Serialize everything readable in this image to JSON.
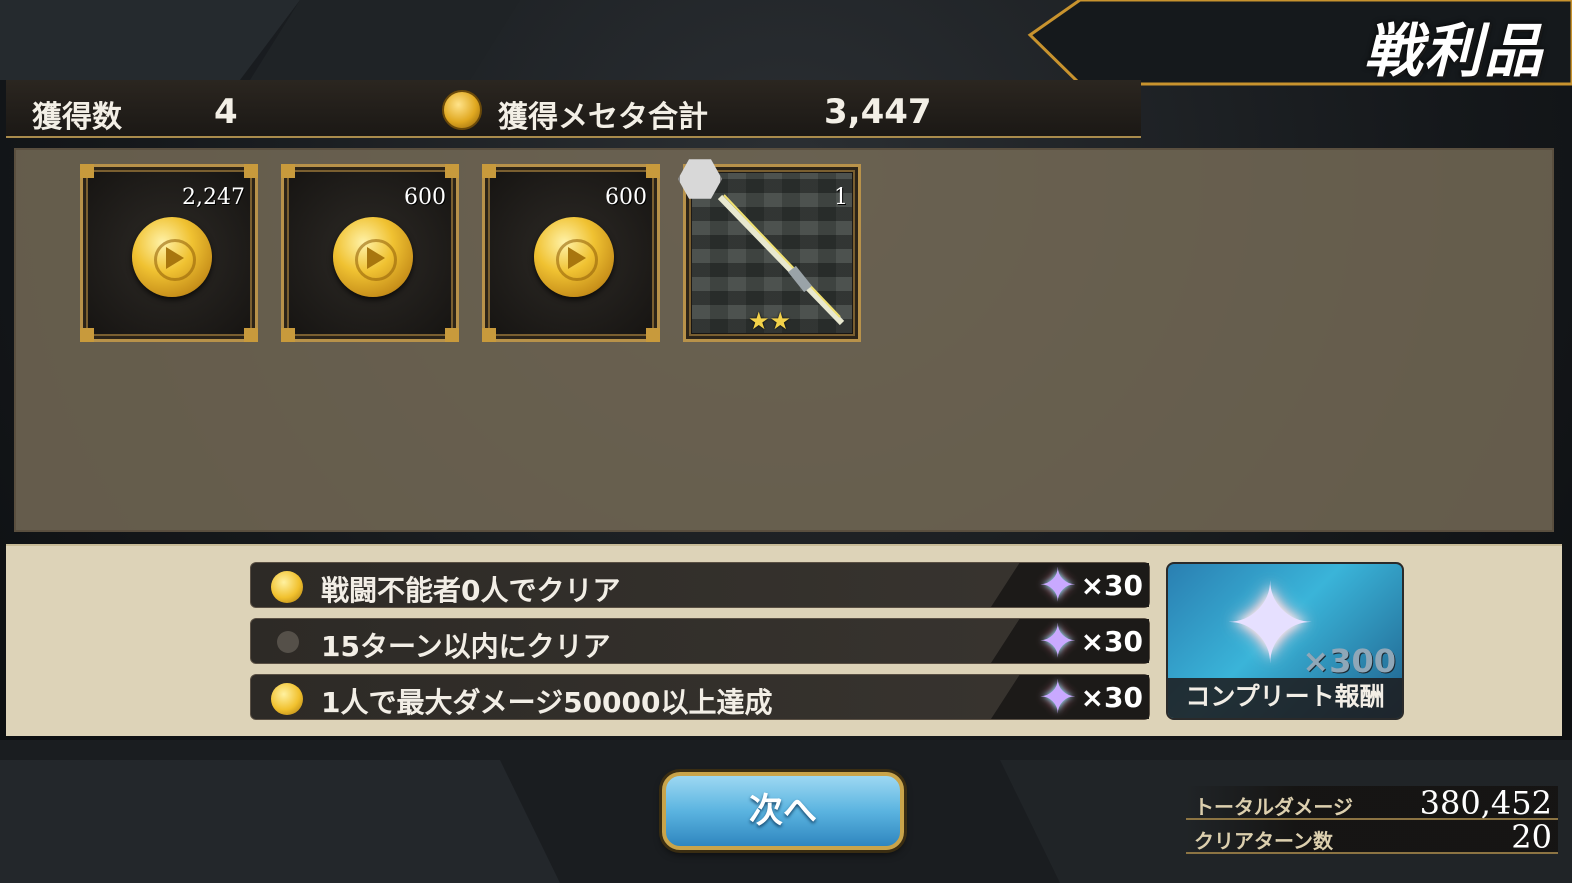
{
  "screen": {
    "title": "戦利品"
  },
  "summary": {
    "count_label": "獲得数",
    "count_value": "4",
    "meseta_label": "獲得メセタ合計",
    "meseta_value": "3,447"
  },
  "loot": [
    {
      "type": "meseta",
      "qty": "2,247",
      "icon": "gold-coin-icon"
    },
    {
      "type": "meseta",
      "qty": "600",
      "icon": "gold-coin-icon"
    },
    {
      "type": "meseta",
      "qty": "600",
      "icon": "gold-coin-icon"
    },
    {
      "type": "weapon",
      "qty": "1",
      "icon": "sword-icon",
      "stars": "★★"
    }
  ],
  "missions": [
    {
      "text": "戦闘不能者0人でクリア",
      "achieved": true,
      "reward": "×30",
      "reward_icon": "star-gem-icon"
    },
    {
      "text": "15ターン以内にクリア",
      "achieved": false,
      "reward": "×30",
      "reward_icon": "star-gem-icon"
    },
    {
      "text": "1人で最大ダメージ50000以上達成",
      "achieved": true,
      "reward": "×30",
      "reward_icon": "star-gem-icon"
    }
  ],
  "complete_reward": {
    "multiplier": "×300",
    "label": "コンプリート報酬",
    "icon": "star-gem-icon"
  },
  "next_button": {
    "label": "次へ"
  },
  "stats": {
    "total_damage_label": "トータルダメージ",
    "total_damage_value": "380,452",
    "clear_turns_label": "クリアターン数",
    "clear_turns_value": "20"
  },
  "colors": {
    "gold_accent": "#c89a3c",
    "panel": "#ddd3b8",
    "button_blue": "#5bb4e0"
  }
}
